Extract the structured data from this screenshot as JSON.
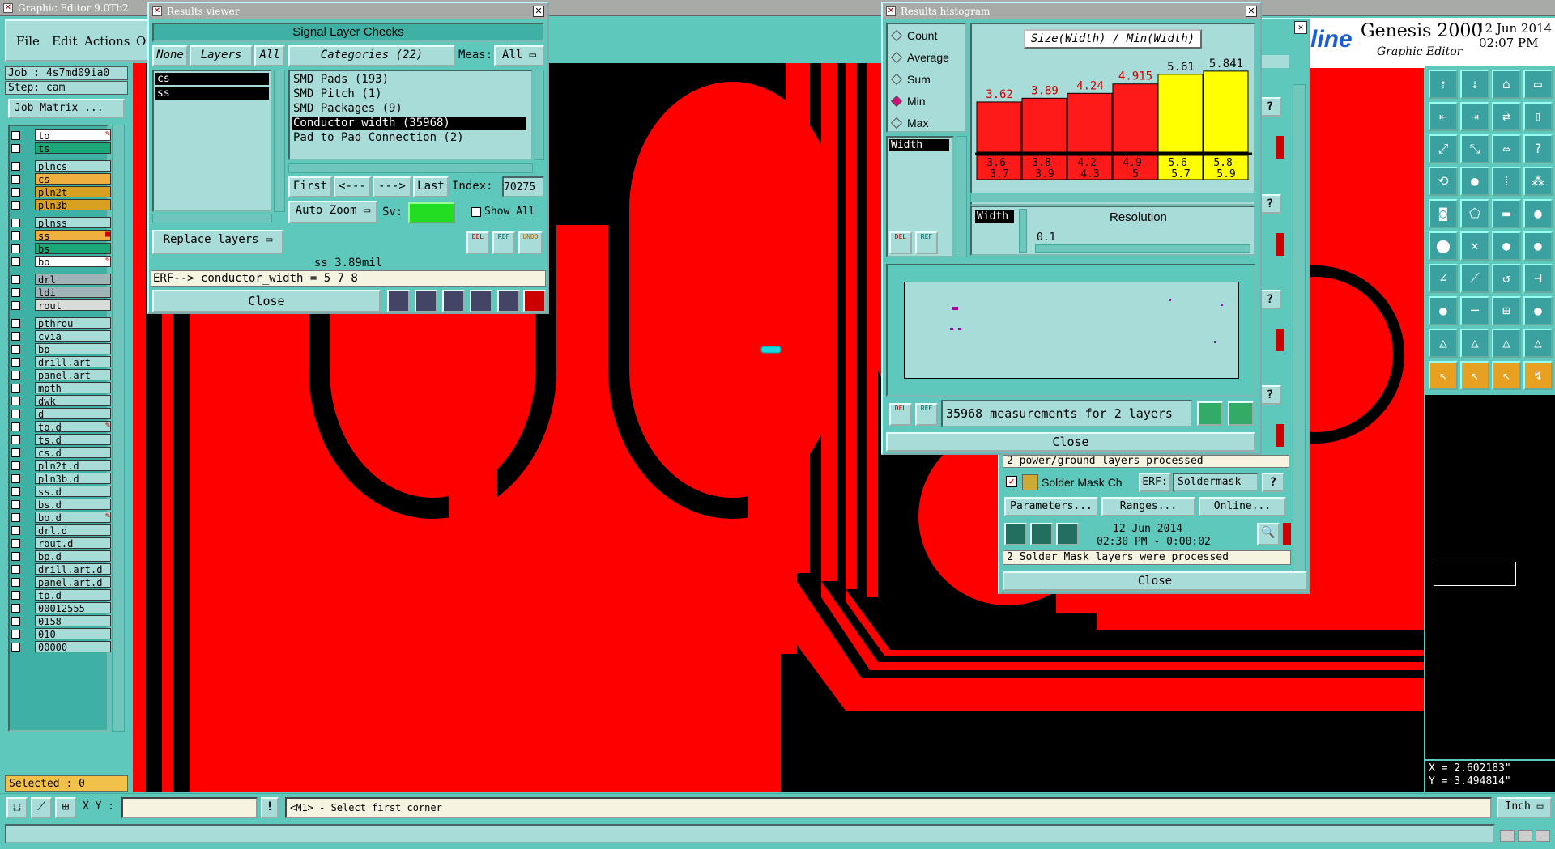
{
  "app": {
    "title": "Graphic Editor 9.0Tb2",
    "menu": [
      "File",
      "Edit",
      "Actions",
      "O"
    ],
    "brand_suffix": "line",
    "brand_name": "Genesis 2000",
    "brand_sub": "Graphic Editor",
    "date": "12 Jun 2014",
    "time": "02:07 PM"
  },
  "job": {
    "job_label": "Job : 4s7md09ia0",
    "step_label": "Step: cam",
    "matrix_button": "Job Matrix ...",
    "selected": "Selected : 0"
  },
  "layers": [
    {
      "name": "to",
      "color": "#ffffff",
      "mark": "✎"
    },
    {
      "name": "ts",
      "color": "#1aa878",
      "mark": ""
    },
    {
      "name": "plncs",
      "color": "#a8dcd8",
      "mark": ""
    },
    {
      "name": "cs",
      "color": "#f0b040",
      "mark": ""
    },
    {
      "name": "pln2t",
      "color": "#d8a020",
      "mark": ""
    },
    {
      "name": "pln3b",
      "color": "#d8a020",
      "mark": ""
    },
    {
      "name": "plnss",
      "color": "#a8dcd8",
      "mark": ""
    },
    {
      "name": "ss",
      "color": "#f0b040",
      "mark": "■"
    },
    {
      "name": "bs",
      "color": "#1aa878",
      "mark": ""
    },
    {
      "name": "bo",
      "color": "#ffffff",
      "mark": "✎"
    },
    {
      "name": "drl",
      "color": "#a0b4b8",
      "mark": ""
    },
    {
      "name": "ldi",
      "color": "#a0b4b8",
      "mark": ""
    },
    {
      "name": "rout",
      "color": "#d8dcd8",
      "mark": ""
    },
    {
      "name": "pthrou",
      "color": "#a8dcd8",
      "mark": ""
    },
    {
      "name": "cvia",
      "color": "#a8dcd8",
      "mark": ""
    },
    {
      "name": "bp",
      "color": "#a8dcd8",
      "mark": ""
    },
    {
      "name": "drill.art",
      "color": "#a8dcd8",
      "mark": ""
    },
    {
      "name": "panel.art",
      "color": "#a8dcd8",
      "mark": ""
    },
    {
      "name": "mpth",
      "color": "#a8dcd8",
      "mark": ""
    },
    {
      "name": "dwk",
      "color": "#a8dcd8",
      "mark": ""
    },
    {
      "name": "d",
      "color": "#a8dcd8",
      "mark": ""
    },
    {
      "name": "to.d",
      "color": "#a8dcd8",
      "mark": "✎"
    },
    {
      "name": "ts.d",
      "color": "#a8dcd8",
      "mark": ""
    },
    {
      "name": "cs.d",
      "color": "#a8dcd8",
      "mark": ""
    },
    {
      "name": "pln2t.d",
      "color": "#a8dcd8",
      "mark": ""
    },
    {
      "name": "pln3b.d",
      "color": "#a8dcd8",
      "mark": ""
    },
    {
      "name": "ss.d",
      "color": "#a8dcd8",
      "mark": ""
    },
    {
      "name": "bs.d",
      "color": "#a8dcd8",
      "mark": ""
    },
    {
      "name": "bo.d",
      "color": "#a8dcd8",
      "mark": "✎"
    },
    {
      "name": "drl.d",
      "color": "#a8dcd8",
      "mark": ""
    },
    {
      "name": "rout.d",
      "color": "#a8dcd8",
      "mark": ""
    },
    {
      "name": "bp.d",
      "color": "#a8dcd8",
      "mark": ""
    },
    {
      "name": "drill.art.d",
      "color": "#a8dcd8",
      "mark": ""
    },
    {
      "name": "panel.art.d",
      "color": "#a8dcd8",
      "mark": ""
    },
    {
      "name": "tp.d",
      "color": "#a8dcd8",
      "mark": ""
    },
    {
      "name": "00012555",
      "color": "#a8dcd8",
      "mark": ""
    },
    {
      "name": "0158",
      "color": "#a8dcd8",
      "mark": ""
    },
    {
      "name": "010",
      "color": "#a8dcd8",
      "mark": ""
    },
    {
      "name": "00000",
      "color": "#a8dcd8",
      "mark": ""
    }
  ],
  "results_viewer": {
    "title": "Results viewer",
    "header": "Signal Layer Checks",
    "btn_none": "None",
    "btn_layers": "Layers",
    "btn_all": "All",
    "categories_label": "Categories (22)",
    "meas_label": "Meas:",
    "meas_value": "All",
    "layer_list": [
      "cs",
      "ss"
    ],
    "categories": [
      "SMD Pads (193)",
      "SMD Pitch (1)",
      "SMD Packages (9)",
      "Conductor width (35968)",
      "Pad to Pad Connection (2)"
    ],
    "selected_category": 3,
    "nav": {
      "first": "First",
      "prev": "<---",
      "next": "--->",
      "last": "Last",
      "index_label": "Index:",
      "index_value": "70275"
    },
    "auto_zoom": "Auto Zoom",
    "sv_label": "Sv:",
    "show_all": "Show All",
    "replace_layers": "Replace layers",
    "icon_del": "DEL",
    "icon_ref": "REF",
    "icon_undo": "UNDO",
    "status": "ss 3.89mil",
    "erf": "ERF--> conductor_width = 5 7 8",
    "close": "Close"
  },
  "histogram": {
    "title": "Results histogram",
    "options": [
      "Count",
      "Average",
      "Sum",
      "Min",
      "Max"
    ],
    "selected_option": 3,
    "field": "Width",
    "chart_title": "Size(Width) / Min(Width)",
    "resolution_label": "Resolution",
    "resolution_value": "0.1",
    "resolution_field": "Width",
    "summary": "35968 measurements for 2 layers",
    "close": "Close",
    "icon_del": "DEL",
    "icon_ref": "REF"
  },
  "chart_data": {
    "type": "bar",
    "title": "Size(Width) / Min(Width)",
    "categories": [
      "3.6-3.7",
      "3.8-3.9",
      "4.2-4.3",
      "4.9-5",
      "5.6-5.7",
      "5.8-5.9"
    ],
    "values": [
      3.62,
      3.89,
      4.24,
      4.915,
      5.61,
      5.841
    ],
    "value_labels": [
      "3.62",
      "3.89",
      "4.24",
      "4.915",
      "5.61",
      "5.841"
    ],
    "colors": [
      "#ff1a1a",
      "#ff1a1a",
      "#ff1a1a",
      "#ff1a1a",
      "#ffff00",
      "#ffff00"
    ],
    "label_colors": [
      "#d00000",
      "#d00000",
      "#d00000",
      "#d00000",
      "#000000",
      "#000000"
    ],
    "ylim": [
      0,
      7
    ]
  },
  "checks_window": {
    "status1": "2 power/ground layers processed",
    "solder_label": "Solder Mask Ch",
    "erf_label": "ERF:",
    "erf_value": "Soldermask",
    "parameters": "Parameters...",
    "ranges": "Ranges...",
    "online": "Online...",
    "date": "12 Jun 2014",
    "time": "02:30 PM - 0:00:02",
    "status2": "2 Solder Mask layers were processed",
    "close": "Close"
  },
  "coords": {
    "x": "X = 2.602183\"",
    "y": "Y = 3.494814\""
  },
  "bottom": {
    "xy_label": "X Y :",
    "xy_value": "",
    "message": "<M1> - Select first corner",
    "unit": "Inch"
  },
  "colors": {
    "copper": "#ff0000",
    "bg": "#000000",
    "ui": "#5ec8bc",
    "panel": "#a8dcd8"
  }
}
